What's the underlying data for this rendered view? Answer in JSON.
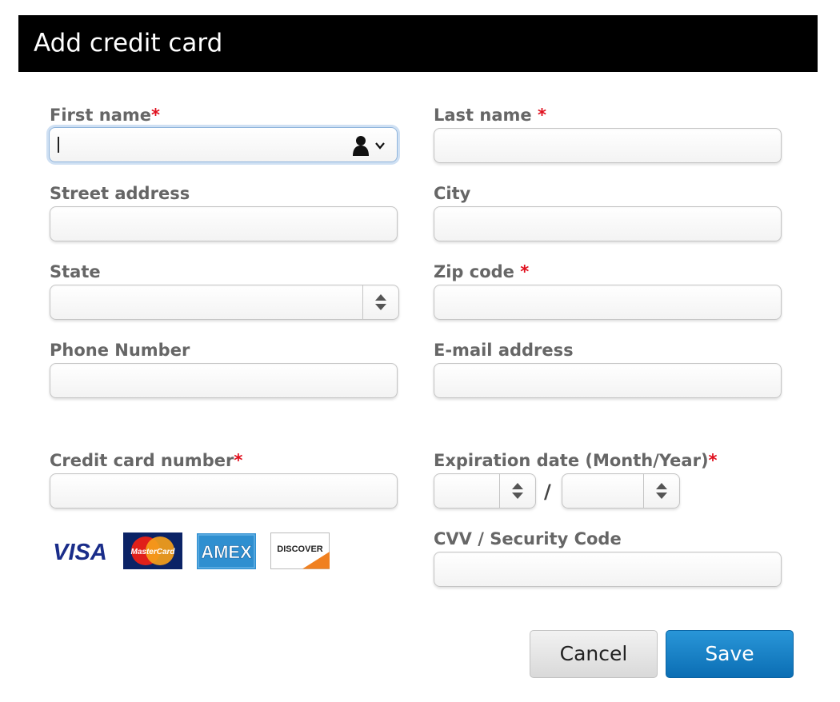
{
  "dialog": {
    "title": "Add credit card"
  },
  "fields": {
    "first_name": {
      "label": "First name",
      "required": "*",
      "value": ""
    },
    "last_name": {
      "label": "Last name ",
      "required": "*",
      "value": ""
    },
    "street_address": {
      "label": "Street address",
      "value": ""
    },
    "city": {
      "label": "City",
      "value": ""
    },
    "state": {
      "label": "State",
      "value": ""
    },
    "zip_code": {
      "label": "Zip code ",
      "required": "*",
      "value": ""
    },
    "phone_number": {
      "label": "Phone Number",
      "value": ""
    },
    "email_address": {
      "label": "E-mail address",
      "value": ""
    },
    "credit_card_number": {
      "label": "Credit card number",
      "required": "*",
      "value": ""
    },
    "expiration_date": {
      "label": "Expiration date (Month/Year)",
      "required": "*",
      "separator": "/",
      "month": "",
      "year": ""
    },
    "cvv": {
      "label": "CVV / Security Code",
      "value": ""
    }
  },
  "card_logos": {
    "visa": "VISA",
    "mastercard": "MasterCard",
    "amex": "AMEX",
    "discover": "DISCOVER"
  },
  "buttons": {
    "cancel": "Cancel",
    "save": "Save"
  },
  "colors": {
    "title_bg": "#000000",
    "required": "#e0101e",
    "save": "#1a82c8",
    "focus": "#8fb4dc"
  }
}
